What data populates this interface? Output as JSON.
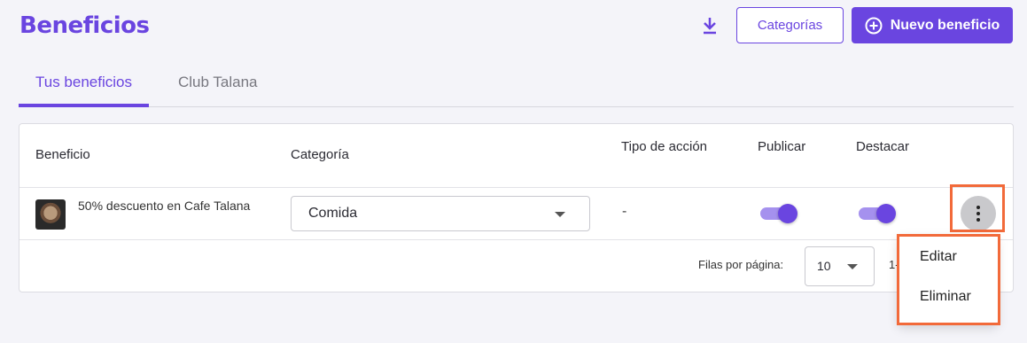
{
  "page": {
    "title": "Beneficios",
    "actions": {
      "categories_label": "Categorías",
      "new_label": "Nuevo beneficio"
    }
  },
  "tabs": [
    {
      "label": "Tus beneficios",
      "active": true
    },
    {
      "label": "Club Talana",
      "active": false
    }
  ],
  "table": {
    "headers": {
      "beneficio": "Beneficio",
      "categoria": "Categoría",
      "tipo_accion": "Tipo de acción",
      "publicar": "Publicar",
      "destacar": "Destacar"
    },
    "rows": [
      {
        "name": "50% descuento en Cafe Talana",
        "category": "Comida",
        "action_type": "-",
        "publicar": true,
        "destacar": true
      }
    ]
  },
  "pagination": {
    "rows_label": "Filas por página:",
    "rows_value": "10",
    "range_text": "1-"
  },
  "row_menu": {
    "items": [
      "Editar",
      "Eliminar"
    ]
  },
  "colors": {
    "primary": "#6a45e0",
    "highlight": "#f26a3a"
  }
}
